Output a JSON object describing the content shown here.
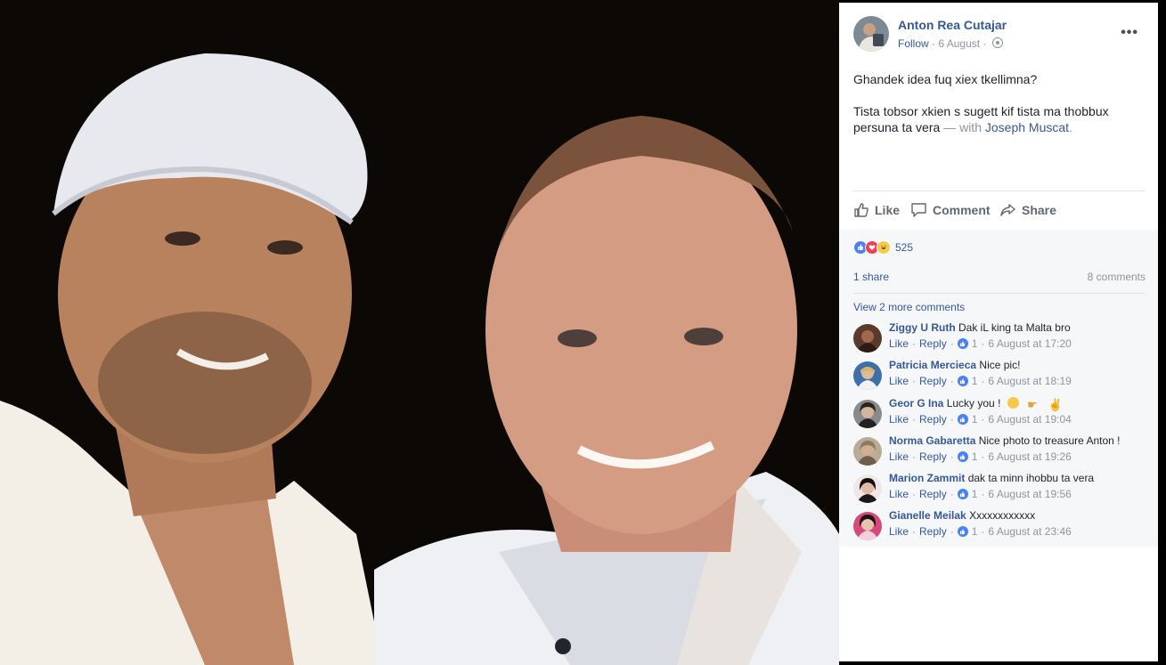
{
  "post": {
    "author": "Anton Rea Cutajar",
    "follow": "Follow",
    "sep": "·",
    "date": "6 August",
    "more": "•••",
    "text_line1": "Ghandek idea fuq xiex tkellimna?",
    "text_line2": "Tista tobsor xkien s sugett kif tista ma thobbux persuna ta vera",
    "with_prefix": "— with",
    "tagged": "Joseph Muscat",
    "tagged_suffix": "."
  },
  "actions": {
    "like": "Like",
    "comment": "Comment",
    "share": "Share"
  },
  "reactions": {
    "count": "525",
    "types": [
      "like-icon",
      "love-icon",
      "haha-icon"
    ]
  },
  "stats": {
    "shares": "1 share",
    "comments": "8 comments"
  },
  "view_more": "View 2 more comments",
  "comments": [
    {
      "name": "Ziggy U Ruth",
      "text": "Dak iL king ta Malta bro",
      "like": "Like",
      "reply": "Reply",
      "likes": "1",
      "time": "6 August at 17:20"
    },
    {
      "name": "Patricia Mercieca",
      "text": "Nice pic!",
      "like": "Like",
      "reply": "Reply",
      "likes": "1",
      "time": "6 August at 18:19"
    },
    {
      "name": "Geor G Ina",
      "text": "Lucky you !",
      "like": "Like",
      "reply": "Reply",
      "likes": "1",
      "time": "6 August at 19:04"
    },
    {
      "name": "Norma Gabaretta",
      "text": "Nice photo to treasure Anton !",
      "like": "Like",
      "reply": "Reply",
      "likes": "1",
      "time": "6 August at 19:26"
    },
    {
      "name": "Marion Zammit",
      "text": "dak ta minn ihobbu ta vera",
      "like": "Like",
      "reply": "Reply",
      "likes": "1",
      "time": "6 August at 19:56"
    },
    {
      "name": "Gianelle Meilak",
      "text": "Xxxxxxxxxxxx",
      "like": "Like",
      "reply": "Reply",
      "likes": "1",
      "time": "6 August at 23:46"
    }
  ],
  "colors": {
    "link": "#365899",
    "meta": "#90949c",
    "like_blue": "#4a80f5",
    "love_red": "#f33e58",
    "haha_yellow": "#f7c948"
  }
}
